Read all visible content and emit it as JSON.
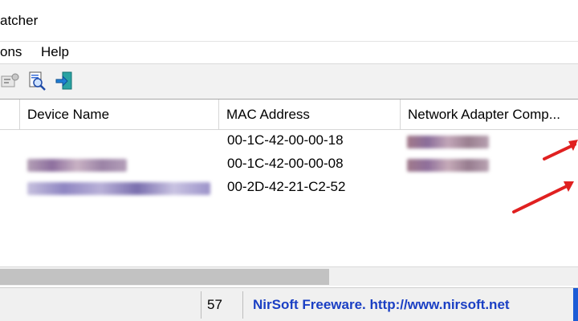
{
  "window": {
    "title": "atcher"
  },
  "menu": {
    "items": [
      "ons",
      "Help"
    ]
  },
  "toolbar": {
    "buttons": [
      "properties-icon",
      "search-icon",
      "exit-icon"
    ]
  },
  "table": {
    "columns": [
      "Device Name",
      "MAC Address",
      "Network Adapter Comp..."
    ],
    "rows": [
      {
        "device_name": "",
        "mac_address": "00-1C-42-00-00-18",
        "adapter_company": ""
      },
      {
        "device_name": "",
        "mac_address": "00-1C-42-00-00-08",
        "adapter_company": ""
      },
      {
        "device_name": "",
        "mac_address": "00-2D-42-21-C2-52",
        "adapter_company": ""
      }
    ]
  },
  "statusbar": {
    "count": "57",
    "link_text": "NirSoft Freeware.  http://www.nirsoft.net"
  },
  "colors": {
    "annotation_arrow": "#e02020",
    "link": "#1a3fc4",
    "accent": "#1c5bd6"
  }
}
